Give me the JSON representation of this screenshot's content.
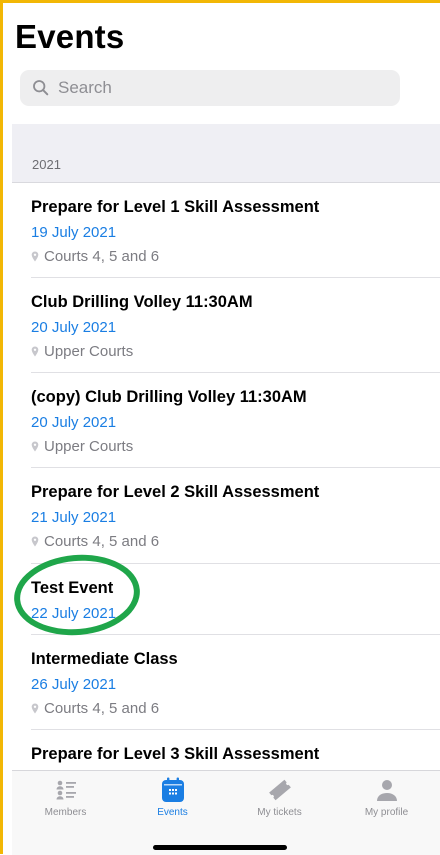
{
  "header": {
    "title": "Events"
  },
  "search": {
    "placeholder": "Search"
  },
  "section": {
    "label": "2021"
  },
  "events": [
    {
      "title": "Prepare for Level 1 Skill Assessment",
      "date": "19 July 2021",
      "location": "Courts 4, 5 and 6"
    },
    {
      "title": "Club Drilling Volley 11:30AM",
      "date": "20 July 2021",
      "location": "Upper Courts"
    },
    {
      "title": "(copy) Club Drilling Volley 11:30AM",
      "date": "20 July 2021",
      "location": "Upper Courts"
    },
    {
      "title": "Prepare for Level 2 Skill Assessment",
      "date": "21 July 2021",
      "location": "Courts 4, 5 and 6"
    },
    {
      "title": "Test Event",
      "date": "22 July 2021",
      "location": ""
    },
    {
      "title": "Intermediate Class",
      "date": "26 July 2021",
      "location": "Courts 4, 5 and 6"
    },
    {
      "title": "Prepare for Level 3 Skill Assessment",
      "date": "",
      "location": ""
    }
  ],
  "tabbar": {
    "tabs": [
      {
        "label": "Members",
        "icon": "members-icon"
      },
      {
        "label": "Events",
        "icon": "calendar-icon",
        "active": true
      },
      {
        "label": "My tickets",
        "icon": "ticket-icon"
      },
      {
        "label": "My profile",
        "icon": "profile-icon"
      }
    ]
  },
  "colors": {
    "accent": "#1a7ee3",
    "annotation": "#1fa64a",
    "frame": "#f2b705"
  }
}
